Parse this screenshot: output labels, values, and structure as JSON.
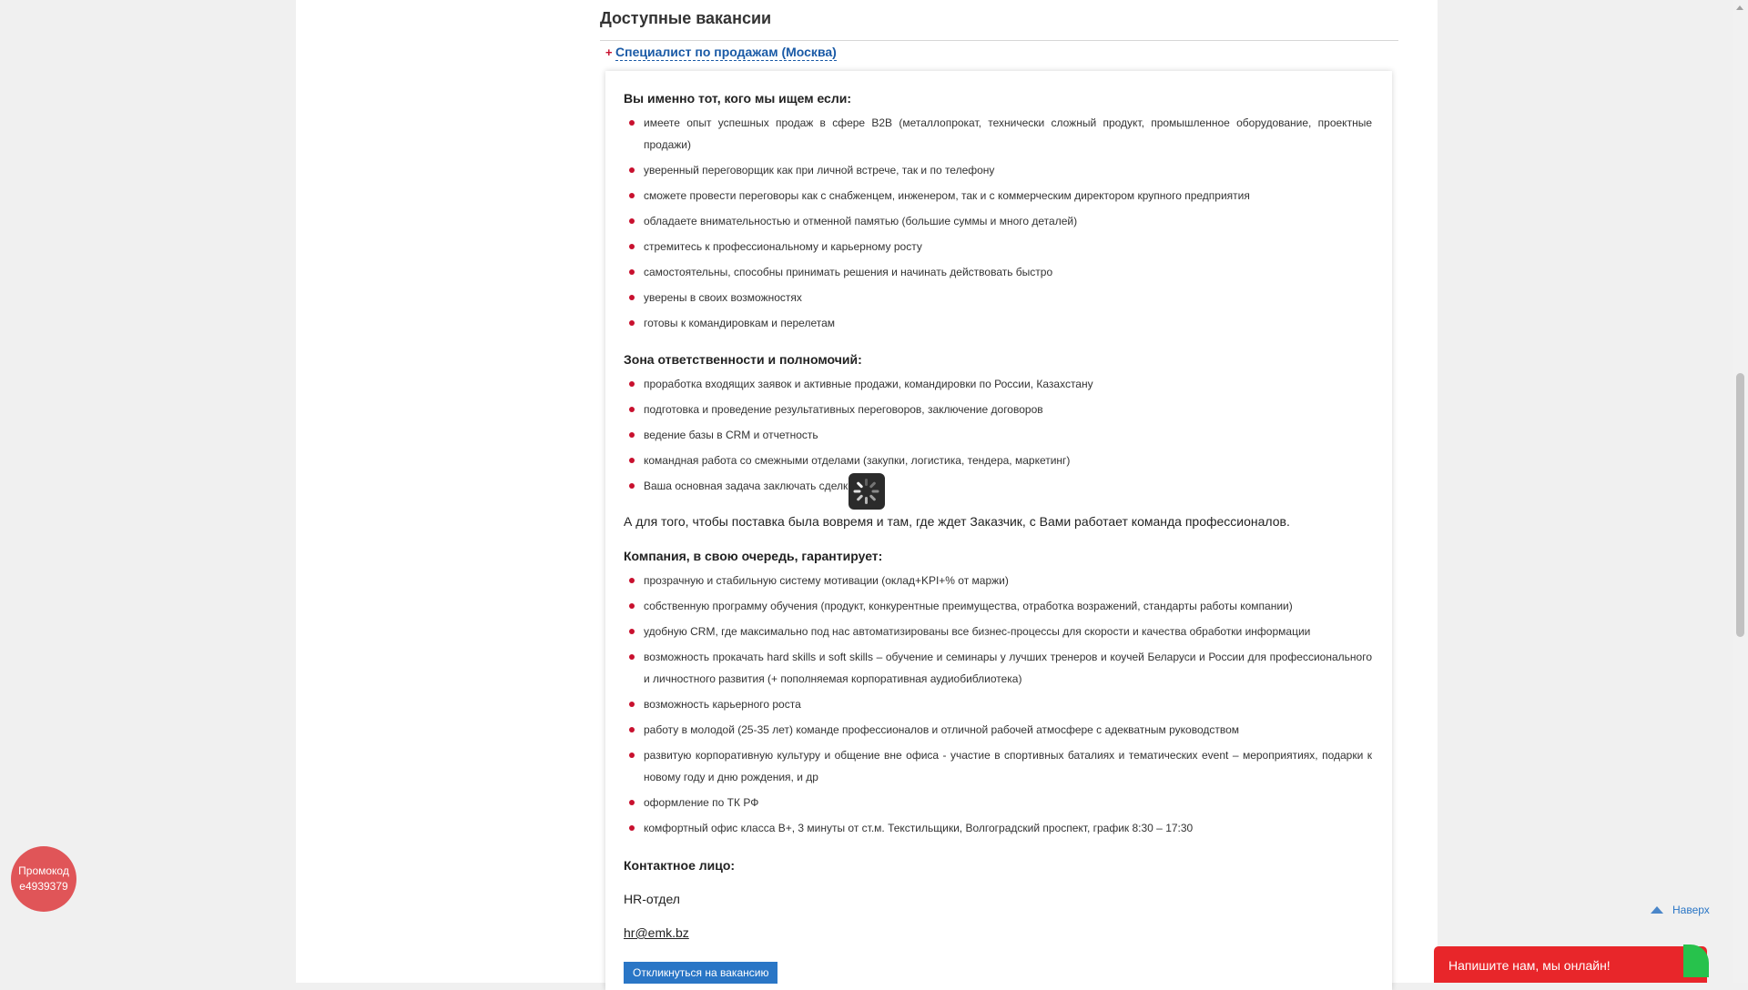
{
  "section": {
    "title": "Доступные вакансии"
  },
  "vacancy": {
    "toggle": "+",
    "title": "Специалист по продажам (Москва)"
  },
  "requirements": {
    "heading": "Вы именно тот, кого мы ищем если:",
    "items": [
      "имеете опыт успешных продаж в сфере B2B (металлопрокат, технически сложный продукт, промышленное оборудование, проектные продажи)",
      "уверенный переговорщик как при личной встрече, так и по телефону",
      "сможете провести переговоры как с снабженцем, инженером, так и с коммерческим директором крупного предприятия",
      "обладаете внимательностью и отменной памятью (большие суммы и много деталей)",
      "стремитесь к профессиональному и карьерному росту",
      "самостоятельны, способны принимать решения и начинать действовать быстро",
      "уверены в своих возможностях",
      "готовы к командировкам и перелетам"
    ]
  },
  "responsibilities": {
    "heading": "Зона ответственности и полномочий:",
    "items": [
      "проработка входящих заявок и активные продажи, командировки по России, Казахстану",
      "подготовка и проведение результативных переговоров, заключение договоров",
      "ведение базы в CRM и отчетность",
      "командная работа со смежными отделами (закупки, логистика, тендера, маркетинг)",
      "Ваша основная задача заключать сделки"
    ]
  },
  "team_text": "А для того, чтобы поставка была вовремя и там, где ждет Заказчик, с Вами работает команда профессионалов.",
  "guarantees": {
    "heading": "Компания, в свою очередь, гарантирует:",
    "items": [
      "прозрачную и стабильную систему мотивации (оклад+KPI+% от маржи)",
      "собственную программу обучения (продукт, конкурентные преимущества, отработка возражений, стандарты работы компании)",
      "удобную CRM, где максимально под нас автоматизированы все бизнес-процессы для скорости и качества обработки информации",
      "возможность прокачать hard skills и soft skills – обучение и семинары у лучших тренеров и коучей Беларуси и России для профессионального и личностного развития (+ пополняемая корпоративная аудиобиблиотека)",
      "возможность карьерного роста",
      "работу в молодой (25-35 лет) команде профессионалов и отличной рабочей атмосфере с адекватным руководством",
      "развитую корпоративную культуру и общение вне офиса - участие в спортивных баталиях и тематических event – мероприятиях, подарки к новому году и дню рождения, и др",
      "оформление по ТК РФ",
      "комфортный офис класса B+, 3 минуты от ст.м. Текстильщики, Волгоградский проспект, график 8:30 – 17:30"
    ]
  },
  "contact": {
    "heading": "Контактное лицо:",
    "department": "HR-отдел",
    "email": "hr@emk.bz"
  },
  "apply_button": "Откликнуться на вакансию",
  "promo": {
    "line1": "Промокод",
    "line2": "e4939379"
  },
  "to_top": "Наверх",
  "chat": "Напишите нам, мы онлайн!",
  "colors": {
    "accent_red": "#c8102e",
    "link_blue": "#1a5aa6",
    "button_blue": "#2a76c6",
    "promo_red": "#e05558",
    "chat_red": "#e8262a",
    "chat_green": "#27c24c"
  },
  "icons": [
    "loading-spinner-icon",
    "arrow-up-icon",
    "bullet-icon"
  ]
}
